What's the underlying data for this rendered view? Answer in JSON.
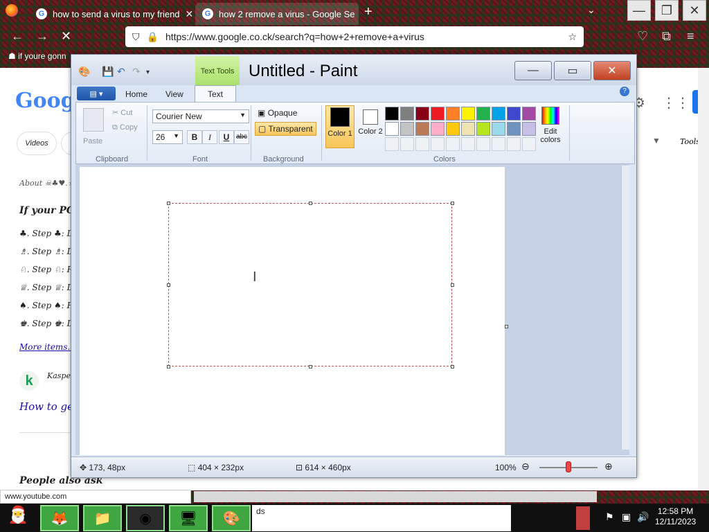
{
  "browser": {
    "tabs": [
      {
        "title": "how to send a virus to my friend",
        "active": false
      },
      {
        "title": "how 2 remove a virus - Google Se",
        "active": true
      }
    ],
    "new_tab": "+",
    "url": "https://www.google.co.ck/search?q=how+2+remove+a+virus",
    "bookmark": "if youre gonn",
    "status_url": "www.youtube.com"
  },
  "google": {
    "logo": "Google",
    "pills": [
      "Videos"
    ],
    "lines": [
      "About ☠♣♥.☆☆",
      "If your PC has",
      "♣. Step ♣: D",
      "♗. Step ♗: D",
      "♘. Step ♘: R",
      "♕. Step ♕: D",
      "♠. Step ♠: F",
      "♚. Step ♚: D",
      "More items...",
      "Kaspersky",
      "How to get r",
      "People also ask"
    ],
    "kaspersky_icon": "k",
    "right_pills": [
      "Tools"
    ]
  },
  "paint": {
    "title": "Untitled - Paint",
    "context_tab": "Text Tools",
    "tabs": [
      "Home",
      "View",
      "Text"
    ],
    "active_tab": "Text",
    "clipboard": {
      "paste": "Paste",
      "cut": "Cut",
      "copy": "Copy",
      "label": "Clipboard"
    },
    "font": {
      "family": "Courier New",
      "size": "26",
      "label": "Font",
      "bold": "B",
      "italic": "I",
      "underline": "U",
      "strike": "abc"
    },
    "background": {
      "opaque": "Opaque",
      "transparent": "Transparent",
      "label": "Background"
    },
    "colors": {
      "color1": "Color 1",
      "color2": "Color 2",
      "edit": "Edit colors",
      "label": "Colors",
      "row1": [
        "#000000",
        "#7f7f7f",
        "#880015",
        "#ed1c24",
        "#ff7f27",
        "#fff200",
        "#22b14c",
        "#00a2e8",
        "#3f48cc",
        "#a349a4"
      ],
      "row2": [
        "#ffffff",
        "#c3c3c3",
        "#b97a57",
        "#ffaec9",
        "#ffc90e",
        "#efe4b0",
        "#b5e61d",
        "#99d9ea",
        "#7092be",
        "#c8bfe7"
      ],
      "color1_value": "#000000",
      "color2_value": "#ffffff"
    },
    "status": {
      "cursor": "173, 48px",
      "selection": "404 × 232px",
      "canvas": "614 × 460px",
      "zoom": "100%"
    }
  },
  "taskbar": {
    "time": "12:58 PM",
    "date": "12/11/2023",
    "ds_label": "ds"
  }
}
